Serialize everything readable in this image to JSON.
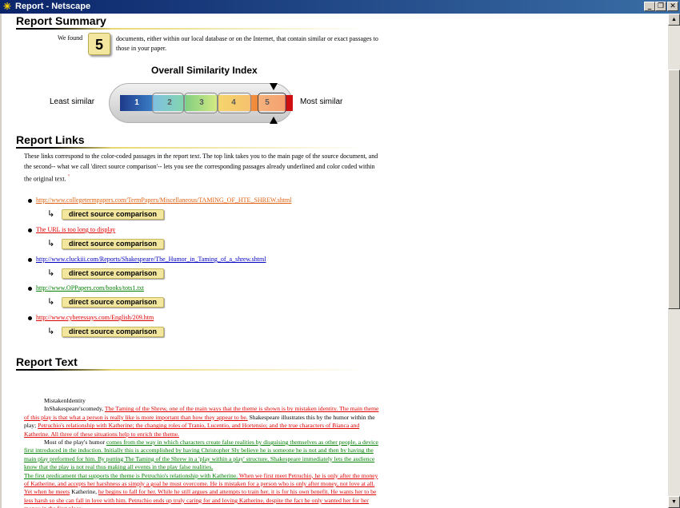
{
  "window": {
    "title": "Report - Netscape",
    "app_icon": "netscape-icon"
  },
  "summary": {
    "heading": "Report Summary",
    "we_found": "We found",
    "count": "5",
    "found_desc_line1": "documents, either within our local database or on the Internet, that contain similar or exact passages",
    "found_desc_line2": "to those in your paper."
  },
  "similarity_index": {
    "title": "Overall Similarity Index",
    "least_label": "Least similar",
    "most_label": "Most similar",
    "scale": [
      "1",
      "2",
      "3",
      "4",
      "5"
    ],
    "selected": "5",
    "colors": [
      "#1f3a8a",
      "#3aa0d0",
      "#3fb53f",
      "#f0c020",
      "#f07020",
      "#d01010"
    ]
  },
  "links": {
    "heading": "Report Links",
    "intro": "These links correspond to the color-coded passages in the report text. The top link takes you to the main page of the source document, and the second-- what we call 'direct source comparison'-- lets you see the corresponding passages already underlined and color coded within the original text.",
    "note_icon": "°",
    "items": [
      {
        "url": "http://www.collegetermpapers.com/TermPapers/Miscellaneous/TAMING_OF_HTE_SHREW.shtml",
        "color": "#e06010",
        "compare_label": "direct source comparison"
      },
      {
        "url": "The URL is too long to display",
        "color": "#e00000",
        "compare_label": "direct source comparison"
      },
      {
        "url": "http://www.cluckiii.com/Reports/Shakespeare/The_Humor_in_Taming_of_a_shrew.shtml",
        "color": "#0000c0",
        "compare_label": "direct source comparison"
      },
      {
        "url": "http://www.OPPapers.com/books/tots1.txt",
        "color": "#008000",
        "compare_label": "direct source comparison"
      },
      {
        "url": "http://www.cyberessays.com/English/209.htm",
        "color": "#e00000",
        "compare_label": "direct source comparison"
      }
    ]
  },
  "report_text": {
    "heading": "Report Text",
    "title_line": "MistakenIdentity",
    "p1_lead": "InShakespeare'scomedy, ",
    "p1_orange": "The Taming of the Shrew, one of the main ways that the theme is shown is by mistaken identity. The main theme of this play is that what a person is really like is more important than how they appear to be.",
    "p1_plain": " Shakespeare illustrates this by the humor within the play; ",
    "p1_red": "Petruchio's relationship with Katherine; the changing roles of Tranio, Lucentio, and Hortensio; and the true characters of Bianca and Katherine. All three of these situations help to enrich the theme.",
    "p2_lead": "Most of the play's humor ",
    "p2_green": "comes from the way in which characters create false realities by disguising themselves as other people, a device first introduced in the induction. Initially this is accomplished by having Christopher Sly believe he is someone he is not and then by having the main play preformed for him. By putting The Taming of the Shrew in a 'play within a play' structure, Shakespeare immediately lets the audience know that the play is not real thus making all events in the play false realities.",
    "p3_green": "The first predicament that supports the theme is Petruchio's relationship with Katherine.",
    "p3_red": " When we first meet Petruchio, he is only after the money of Katherine, and accepts her harshness as simply a goal he must overcome. He is mistaken for a person who is only after money, not love at all. Yet when he meets",
    "p3_plain": " Katherine, ",
    "p3_red2": "he begins to fall for her. While he still argues and attempts to train her, it is for his own benefit. He wants her to be less harsh so she can fall in love with him. Petruchio ends up truly caring for and loving Katherine, despite the fact he only wanted her for her money in the first place."
  }
}
